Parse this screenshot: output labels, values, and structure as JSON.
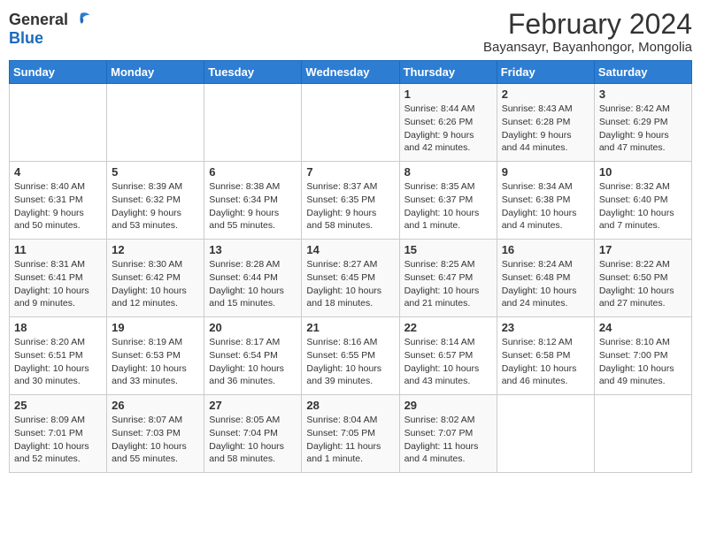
{
  "header": {
    "logo_general": "General",
    "logo_blue": "Blue",
    "title": "February 2024",
    "subtitle": "Bayansayr, Bayanhongor, Mongolia"
  },
  "days_of_week": [
    "Sunday",
    "Monday",
    "Tuesday",
    "Wednesday",
    "Thursday",
    "Friday",
    "Saturday"
  ],
  "weeks": [
    [
      {
        "day": "",
        "info": ""
      },
      {
        "day": "",
        "info": ""
      },
      {
        "day": "",
        "info": ""
      },
      {
        "day": "",
        "info": ""
      },
      {
        "day": "1",
        "info": "Sunrise: 8:44 AM\nSunset: 6:26 PM\nDaylight: 9 hours and 42 minutes."
      },
      {
        "day": "2",
        "info": "Sunrise: 8:43 AM\nSunset: 6:28 PM\nDaylight: 9 hours and 44 minutes."
      },
      {
        "day": "3",
        "info": "Sunrise: 8:42 AM\nSunset: 6:29 PM\nDaylight: 9 hours and 47 minutes."
      }
    ],
    [
      {
        "day": "4",
        "info": "Sunrise: 8:40 AM\nSunset: 6:31 PM\nDaylight: 9 hours and 50 minutes."
      },
      {
        "day": "5",
        "info": "Sunrise: 8:39 AM\nSunset: 6:32 PM\nDaylight: 9 hours and 53 minutes."
      },
      {
        "day": "6",
        "info": "Sunrise: 8:38 AM\nSunset: 6:34 PM\nDaylight: 9 hours and 55 minutes."
      },
      {
        "day": "7",
        "info": "Sunrise: 8:37 AM\nSunset: 6:35 PM\nDaylight: 9 hours and 58 minutes."
      },
      {
        "day": "8",
        "info": "Sunrise: 8:35 AM\nSunset: 6:37 PM\nDaylight: 10 hours and 1 minute."
      },
      {
        "day": "9",
        "info": "Sunrise: 8:34 AM\nSunset: 6:38 PM\nDaylight: 10 hours and 4 minutes."
      },
      {
        "day": "10",
        "info": "Sunrise: 8:32 AM\nSunset: 6:40 PM\nDaylight: 10 hours and 7 minutes."
      }
    ],
    [
      {
        "day": "11",
        "info": "Sunrise: 8:31 AM\nSunset: 6:41 PM\nDaylight: 10 hours and 9 minutes."
      },
      {
        "day": "12",
        "info": "Sunrise: 8:30 AM\nSunset: 6:42 PM\nDaylight: 10 hours and 12 minutes."
      },
      {
        "day": "13",
        "info": "Sunrise: 8:28 AM\nSunset: 6:44 PM\nDaylight: 10 hours and 15 minutes."
      },
      {
        "day": "14",
        "info": "Sunrise: 8:27 AM\nSunset: 6:45 PM\nDaylight: 10 hours and 18 minutes."
      },
      {
        "day": "15",
        "info": "Sunrise: 8:25 AM\nSunset: 6:47 PM\nDaylight: 10 hours and 21 minutes."
      },
      {
        "day": "16",
        "info": "Sunrise: 8:24 AM\nSunset: 6:48 PM\nDaylight: 10 hours and 24 minutes."
      },
      {
        "day": "17",
        "info": "Sunrise: 8:22 AM\nSunset: 6:50 PM\nDaylight: 10 hours and 27 minutes."
      }
    ],
    [
      {
        "day": "18",
        "info": "Sunrise: 8:20 AM\nSunset: 6:51 PM\nDaylight: 10 hours and 30 minutes."
      },
      {
        "day": "19",
        "info": "Sunrise: 8:19 AM\nSunset: 6:53 PM\nDaylight: 10 hours and 33 minutes."
      },
      {
        "day": "20",
        "info": "Sunrise: 8:17 AM\nSunset: 6:54 PM\nDaylight: 10 hours and 36 minutes."
      },
      {
        "day": "21",
        "info": "Sunrise: 8:16 AM\nSunset: 6:55 PM\nDaylight: 10 hours and 39 minutes."
      },
      {
        "day": "22",
        "info": "Sunrise: 8:14 AM\nSunset: 6:57 PM\nDaylight: 10 hours and 43 minutes."
      },
      {
        "day": "23",
        "info": "Sunrise: 8:12 AM\nSunset: 6:58 PM\nDaylight: 10 hours and 46 minutes."
      },
      {
        "day": "24",
        "info": "Sunrise: 8:10 AM\nSunset: 7:00 PM\nDaylight: 10 hours and 49 minutes."
      }
    ],
    [
      {
        "day": "25",
        "info": "Sunrise: 8:09 AM\nSunset: 7:01 PM\nDaylight: 10 hours and 52 minutes."
      },
      {
        "day": "26",
        "info": "Sunrise: 8:07 AM\nSunset: 7:03 PM\nDaylight: 10 hours and 55 minutes."
      },
      {
        "day": "27",
        "info": "Sunrise: 8:05 AM\nSunset: 7:04 PM\nDaylight: 10 hours and 58 minutes."
      },
      {
        "day": "28",
        "info": "Sunrise: 8:04 AM\nSunset: 7:05 PM\nDaylight: 11 hours and 1 minute."
      },
      {
        "day": "29",
        "info": "Sunrise: 8:02 AM\nSunset: 7:07 PM\nDaylight: 11 hours and 4 minutes."
      },
      {
        "day": "",
        "info": ""
      },
      {
        "day": "",
        "info": ""
      }
    ]
  ]
}
